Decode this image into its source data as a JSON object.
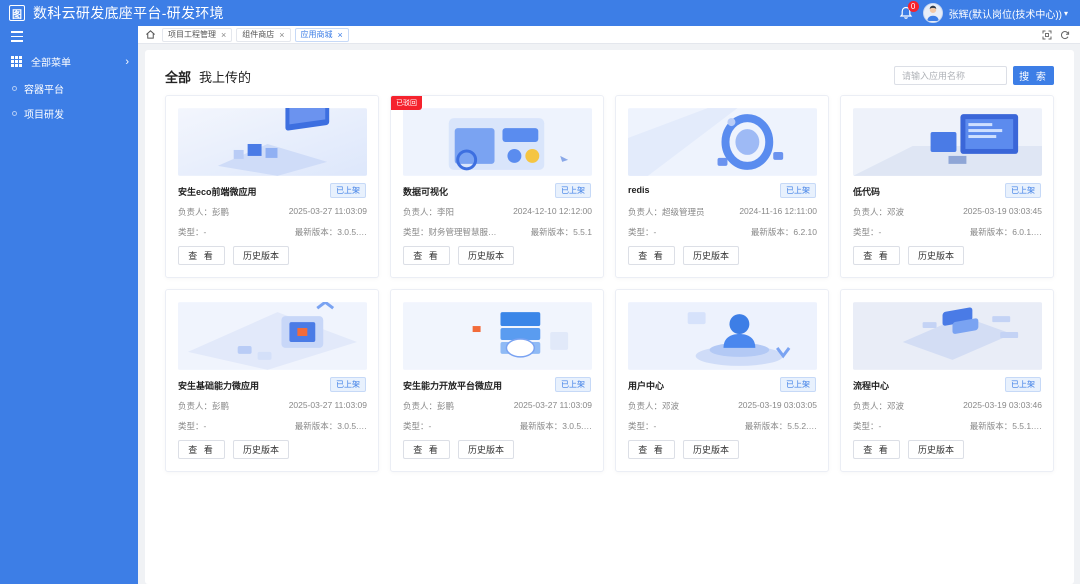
{
  "header": {
    "logo_glyph": "图",
    "title": "数科云研发底座平台-研发环境",
    "notification_count": "0",
    "user_name": "张辉(默认岗位(技术中心))",
    "colors": {
      "primary": "#3d7ee6",
      "danger": "#f5222d"
    }
  },
  "sidebar": {
    "all_menu": "全部菜单",
    "items": [
      {
        "label": "容器平台"
      },
      {
        "label": "项目研发"
      }
    ]
  },
  "tabs": [
    {
      "label": "项目工程管理",
      "active": false
    },
    {
      "label": "组件商店",
      "active": false
    },
    {
      "label": "应用商城",
      "active": true
    }
  ],
  "main": {
    "filter_tabs": [
      {
        "label": "全部",
        "active": true
      },
      {
        "label": "我上传的",
        "active": false
      }
    ],
    "search": {
      "placeholder": "请输入应用名称",
      "value": "",
      "button": "搜 索"
    },
    "labels": {
      "owner": "负责人：",
      "type": "类型：",
      "latest": "最新版本：",
      "view": "查 看",
      "history": "历史版本"
    },
    "cards": [
      {
        "title": "安生eco前端微应用",
        "status": "已上架",
        "owner": "彭鹏",
        "date": "2025-03-27 11:03:09",
        "type": "-",
        "version": "3.0.5.…",
        "icon": "server-illustration"
      },
      {
        "title": "数据可视化",
        "status": "已上架",
        "badge": "已驳回",
        "owner": "李阳",
        "date": "2024-12-10 12:12:00",
        "type": "财务管理智慧服务…",
        "version": "5.5.1",
        "icon": "dashboard-illustration"
      },
      {
        "title": "redis",
        "status": "已上架",
        "owner": "超级管理员",
        "date": "2024-11-16 12:11:00",
        "type": "-",
        "version": "6.2.10",
        "icon": "ring-illustration"
      },
      {
        "title": "低代码",
        "status": "已上架",
        "owner": "邓波",
        "date": "2025-03-19 03:03:45",
        "type": "-",
        "version": "6.0.1.…",
        "icon": "monitor-illustration"
      },
      {
        "title": "安生基础能力微应用",
        "status": "已上架",
        "owner": "彭鹏",
        "date": "2025-03-27 11:03:09",
        "type": "-",
        "version": "3.0.5.…",
        "icon": "chip-illustration"
      },
      {
        "title": "安生能力开放平台微应用",
        "status": "已上架",
        "owner": "彭鹏",
        "date": "2025-03-27 11:03:09",
        "type": "-",
        "version": "3.0.5.…",
        "icon": "cloud-illustration"
      },
      {
        "title": "用户中心",
        "status": "已上架",
        "owner": "邓波",
        "date": "2025-03-19 03:03:05",
        "type": "-",
        "version": "5.5.2.…",
        "icon": "user-illustration"
      },
      {
        "title": "流程中心",
        "status": "已上架",
        "owner": "邓波",
        "date": "2025-03-19 03:03:46",
        "type": "-",
        "version": "5.5.1.…",
        "icon": "flow-illustration"
      }
    ]
  }
}
